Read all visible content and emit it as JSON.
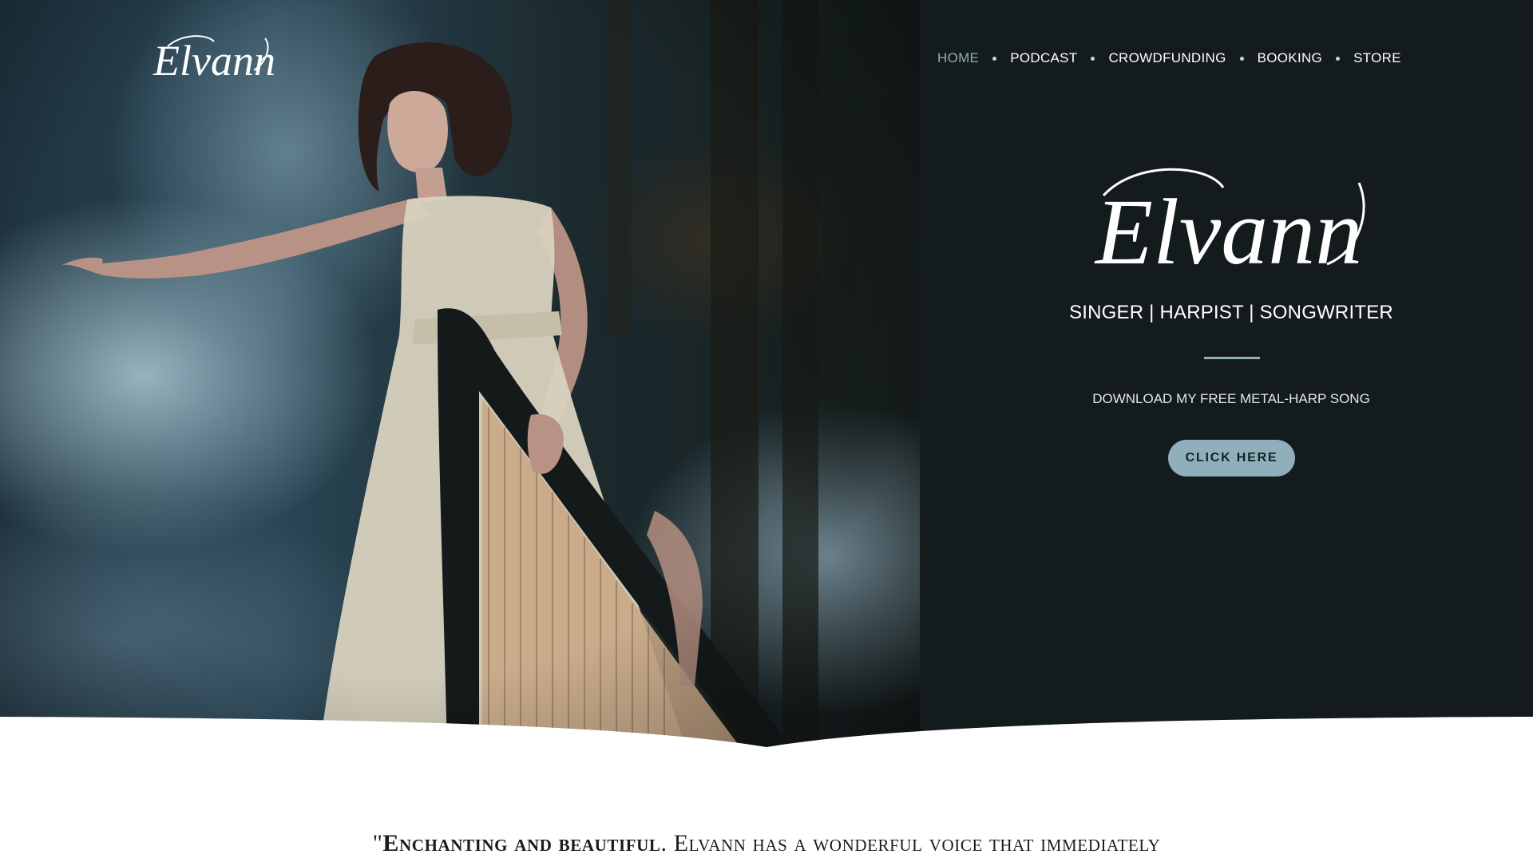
{
  "header": {
    "logo_text": "Elvann",
    "nav": [
      {
        "label": "HOME",
        "active": true
      },
      {
        "label": "PODCAST",
        "active": false
      },
      {
        "label": "CROWDFUNDING",
        "active": false
      },
      {
        "label": "BOOKING",
        "active": false
      },
      {
        "label": "STORE",
        "active": false
      }
    ]
  },
  "hero": {
    "logo_text": "Elvann",
    "tagline": "SINGER | HARPIST | SONGWRITER",
    "download_text": "DOWNLOAD MY FREE METAL-HARP SONG",
    "cta_label": "CLICK HERE"
  },
  "quote": {
    "open_mark": "\"",
    "emphasis": "Enchanting and beautiful",
    "rest": ". Elvann has a wonderful voice that immediately"
  },
  "colors": {
    "dark_panel": "#141b1d",
    "accent": "#8fb0bb",
    "nav_text": "#ffffff"
  }
}
